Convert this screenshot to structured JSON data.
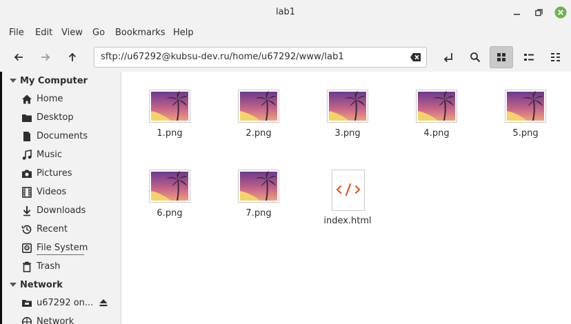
{
  "window": {
    "title": "lab1"
  },
  "menu": [
    "File",
    "Edit",
    "View",
    "Go",
    "Bookmarks",
    "Help"
  ],
  "location": {
    "path": "sftp://u67292@kubsu-dev.ru/home/u67292/www/lab1"
  },
  "sidebar": {
    "my_computer": "My Computer",
    "items": [
      {
        "label": "Home",
        "icon": "home-icon"
      },
      {
        "label": "Desktop",
        "icon": "desktop-icon"
      },
      {
        "label": "Documents",
        "icon": "document-icon"
      },
      {
        "label": "Music",
        "icon": "music-icon"
      },
      {
        "label": "Pictures",
        "icon": "camera-icon"
      },
      {
        "label": "Videos",
        "icon": "film-icon"
      },
      {
        "label": "Downloads",
        "icon": "download-icon"
      },
      {
        "label": "Recent",
        "icon": "clock-icon"
      },
      {
        "label": "File System",
        "icon": "drive-icon"
      },
      {
        "label": "Trash",
        "icon": "trash-icon"
      }
    ],
    "network": "Network",
    "network_items": [
      {
        "label": "u67292 on...",
        "icon": "network-folder-icon"
      },
      {
        "label": "Network",
        "icon": "network-icon"
      }
    ]
  },
  "files": [
    {
      "name": "1.png",
      "type": "image"
    },
    {
      "name": "2.png",
      "type": "image"
    },
    {
      "name": "3.png",
      "type": "image"
    },
    {
      "name": "4.png",
      "type": "image"
    },
    {
      "name": "5.png",
      "type": "image"
    },
    {
      "name": "6.png",
      "type": "image"
    },
    {
      "name": "7.png",
      "type": "image"
    },
    {
      "name": "index.html",
      "type": "html",
      "icon_text": "</>"
    }
  ],
  "colors": {
    "accent_close": "#6fb24f",
    "html_icon": "#e2561f"
  }
}
